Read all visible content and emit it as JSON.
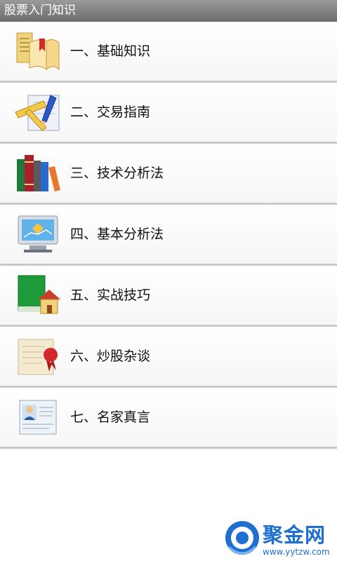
{
  "header": {
    "title": "股票入门知识"
  },
  "menu": {
    "items": [
      {
        "label": "一、基础知识",
        "icon": "open-book-icon"
      },
      {
        "label": "二、交易指南",
        "icon": "ruler-pencil-icon"
      },
      {
        "label": "三、技术分析法",
        "icon": "books-icon"
      },
      {
        "label": "四、基本分析法",
        "icon": "monitor-icon"
      },
      {
        "label": "五、实战技巧",
        "icon": "book-house-icon"
      },
      {
        "label": "六、炒股杂谈",
        "icon": "sealed-letter-icon"
      },
      {
        "label": "七、名家真言",
        "icon": "profile-card-icon"
      }
    ]
  },
  "watermark": {
    "name": "聚金网",
    "url": "www.yytzw.com",
    "color": "#1f6fd1"
  }
}
